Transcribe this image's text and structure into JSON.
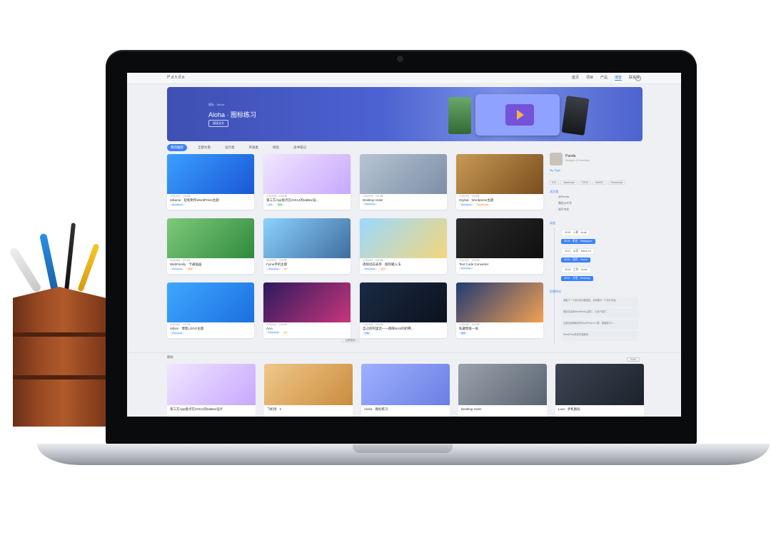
{
  "site": {
    "logo": "Panda",
    "nav": [
      "首页",
      "项目",
      "产品",
      "博客",
      "联系我"
    ],
    "active_nav": 3
  },
  "hero": {
    "breadcrumb": "图标 · Aloha",
    "title": "Aloha · 图标练习",
    "button": "阅读全文"
  },
  "tabs": [
    "我的推荐",
    "全部文章",
    "设计类",
    "开发类",
    "经验",
    "读书笔记"
  ],
  "cards": [
    {
      "title": "nilkame · 轻松制作WordPress主题",
      "meta": "12月10日 · 2019年",
      "tags": [
        {
          "t": "WordPress",
          "c": "b"
        }
      ],
      "thumb": "linear-gradient(135deg,#3aa0ff,#1a56d6)"
    },
    {
      "title": "第三方App接点在iOS12的tabBar设...",
      "meta": "11月20日 · 2019年",
      "tags": [
        {
          "t": "iOS",
          "c": "b"
        },
        {
          "t": "原创",
          "c": "g"
        }
      ],
      "thumb": "linear-gradient(135deg,#f1e6ff,#c8a8ff)"
    },
    {
      "title": "Desktop Holer",
      "meta": "12月10日 · 2019年",
      "tags": [
        {
          "t": "Photoshop",
          "c": "b"
        }
      ],
      "thumb": "linear-gradient(135deg,#b7c4d4,#7d8fa6)"
    },
    {
      "title": "Orphal · Wordpress主题",
      "meta": "11月21日 · 2019年",
      "tags": [
        {
          "t": "Photoshop",
          "c": "b"
        },
        {
          "t": "WordPress",
          "c": "o"
        }
      ],
      "thumb": "linear-gradient(135deg,#c79a55,#7a4d1e)"
    },
    {
      "title": "WebFamily · 卡通插画",
      "meta": "11月28日 · 2019年",
      "tags": [
        {
          "t": "Photoshop",
          "c": "b"
        },
        {
          "t": "原创",
          "c": "o"
        }
      ],
      "thumb": "linear-gradient(135deg,#7fc97a,#2f8a3e)"
    },
    {
      "title": "Fyme手机主题",
      "meta": "11月28日 · 2019年",
      "tags": [
        {
          "t": "Photoshop",
          "c": "b"
        },
        {
          "t": "UI",
          "c": "o"
        }
      ],
      "thumb": "linear-gradient(135deg,#8bd1ff,#3f6e9f)"
    },
    {
      "title": "透视动态表单 · 搜狗输入法",
      "meta": "11月28日 · 2019年",
      "tags": [
        {
          "t": "Photoshop",
          "c": "b"
        },
        {
          "t": "设计",
          "c": "o"
        }
      ],
      "thumb": "linear-gradient(135deg,#9bd8ff,#f3d77a)"
    },
    {
      "title": "Text Code Converter",
      "meta": "11月28日 · 2019年",
      "tags": [
        {
          "t": "Photoshop",
          "c": "b"
        }
      ],
      "thumb": "linear-gradient(135deg,#2d2d2d,#0f0f0f)"
    },
    {
      "title": "rellom · 博客LOGO主题",
      "meta": "11月28日 · 2019年",
      "tags": [
        {
          "t": "Photoshop",
          "c": "b"
        }
      ],
      "thumb": "linear-gradient(135deg,#3fa8ff,#1c6fe0)"
    },
    {
      "title": "AAA",
      "meta": "11月28日 · 2019年",
      "tags": [
        {
          "t": "Photoshop",
          "c": "b"
        },
        {
          "t": "UI",
          "c": "o"
        }
      ],
      "thumb": "linear-gradient(135deg,#2b1a5e,#c8357a)"
    },
    {
      "title": "自己的阿里云——群晖NAS的折腾...",
      "meta": "11月28日 · 2019年",
      "tags": [
        {
          "t": "折腾",
          "c": "b"
        }
      ],
      "thumb": "linear-gradient(135deg,#1a2a44,#0c121e)"
    },
    {
      "title": "私藏壁纸一张",
      "meta": "11月28日 · 2019年",
      "tags": [
        {
          "t": "壁纸",
          "c": "b"
        }
      ],
      "thumb": "linear-gradient(135deg,#213a72,#f3a052)"
    }
  ],
  "load_more": "加载更多",
  "sidebar": {
    "name": "Panda",
    "desc": "Designer & Developer",
    "tags_title": "My Tags",
    "tags": [
      "iOS",
      "Javascript",
      "CSS3",
      "WebGL",
      "Photoshop"
    ],
    "follow_title": "关注我",
    "follow": [
      "@Panda",
      "微信公众号",
      "知乎专栏"
    ],
    "timeline_title": "动态",
    "timeline": [
      {
        "t": "2019 · 入职 · Arali",
        "cls": "light"
      },
      {
        "t": "2018 · 职业 · Wallpaper",
        "cls": "blue"
      },
      {
        "t": "2017 · 公司 · Micro UI",
        "cls": "light"
      },
      {
        "t": "2016 · 项目 · Teach",
        "cls": "blue"
      },
      {
        "t": "2015 · 工作 · Tools",
        "cls": "light"
      },
      {
        "t": "2014 · 开发 · Develop",
        "cls": "blue"
      }
    ],
    "comments_title": "近期评论",
    "comments": [
      "我做了一个设计的问题描述，用来展示一下设计作品...",
      "很喜欢这款WordPress主题了，已经下载了...",
      "主题在最新版本的WordPress 5.3 里，报错是什么...",
      "WordPress的发布速度是..."
    ]
  },
  "section2": {
    "label": "图标",
    "more": "More",
    "cards": [
      {
        "title": "第三方App接点在iOS12的tabBar设计",
        "thumb": "linear-gradient(135deg,#f1e6ff,#c8a8ff)"
      },
      {
        "title": "飞机场 · 2",
        "thumb": "linear-gradient(135deg,#f0c88a,#c98c3e)"
      },
      {
        "title": "Aloha · 图标练习",
        "thumb": "linear-gradient(135deg,#9fb0ff,#6b7fe3)"
      },
      {
        "title": "Desktop Holer",
        "thumb": "linear-gradient(135deg,#9aa3ad,#5a6470)"
      },
      {
        "title": "Lout · 手机图标",
        "thumb": "linear-gradient(135deg,#3d4654,#1c222b)"
      }
    ]
  }
}
